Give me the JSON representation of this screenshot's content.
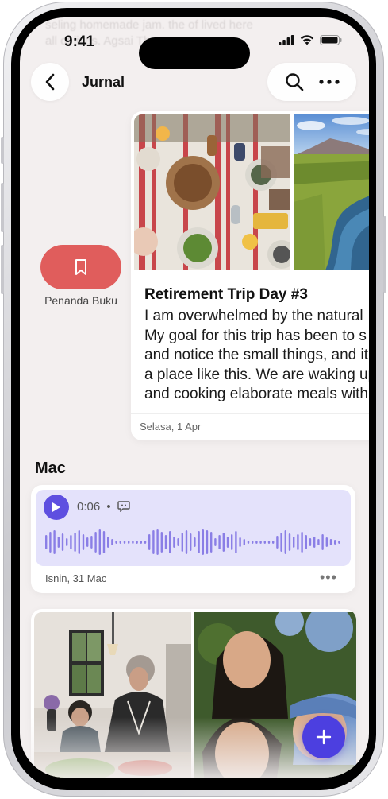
{
  "status": {
    "time": "9:41"
  },
  "background_text": [
    "seling homemade jam. the of lived here",
    "all of lives.    Agsai The"
  ],
  "nav": {
    "title": "Jurnal",
    "back_icon": "chevron-left-icon",
    "search_icon": "search-icon",
    "more_icon": "ellipsis-icon"
  },
  "bookmark": {
    "label": "Penanda Buku",
    "icon": "bookmark-icon",
    "color": "#e05d5c"
  },
  "trip": {
    "title": "Retirement Trip Day #3",
    "lines": [
      "I am overwhelmed by the natural",
      "My goal for this trip has been to s",
      "and notice the small things, and it",
      "a place like this. We are waking up",
      "and cooking elaborate meals with"
    ],
    "date": "Selasa, 1 Apr"
  },
  "section": {
    "title": "Mac"
  },
  "audio": {
    "duration": "0:06",
    "separator": "•",
    "date": "Isnin, 31 Mac",
    "more": "•••",
    "accent": "#5e4fe0"
  },
  "fab": {
    "icon": "plus-icon",
    "color": "#4c3fe0"
  }
}
